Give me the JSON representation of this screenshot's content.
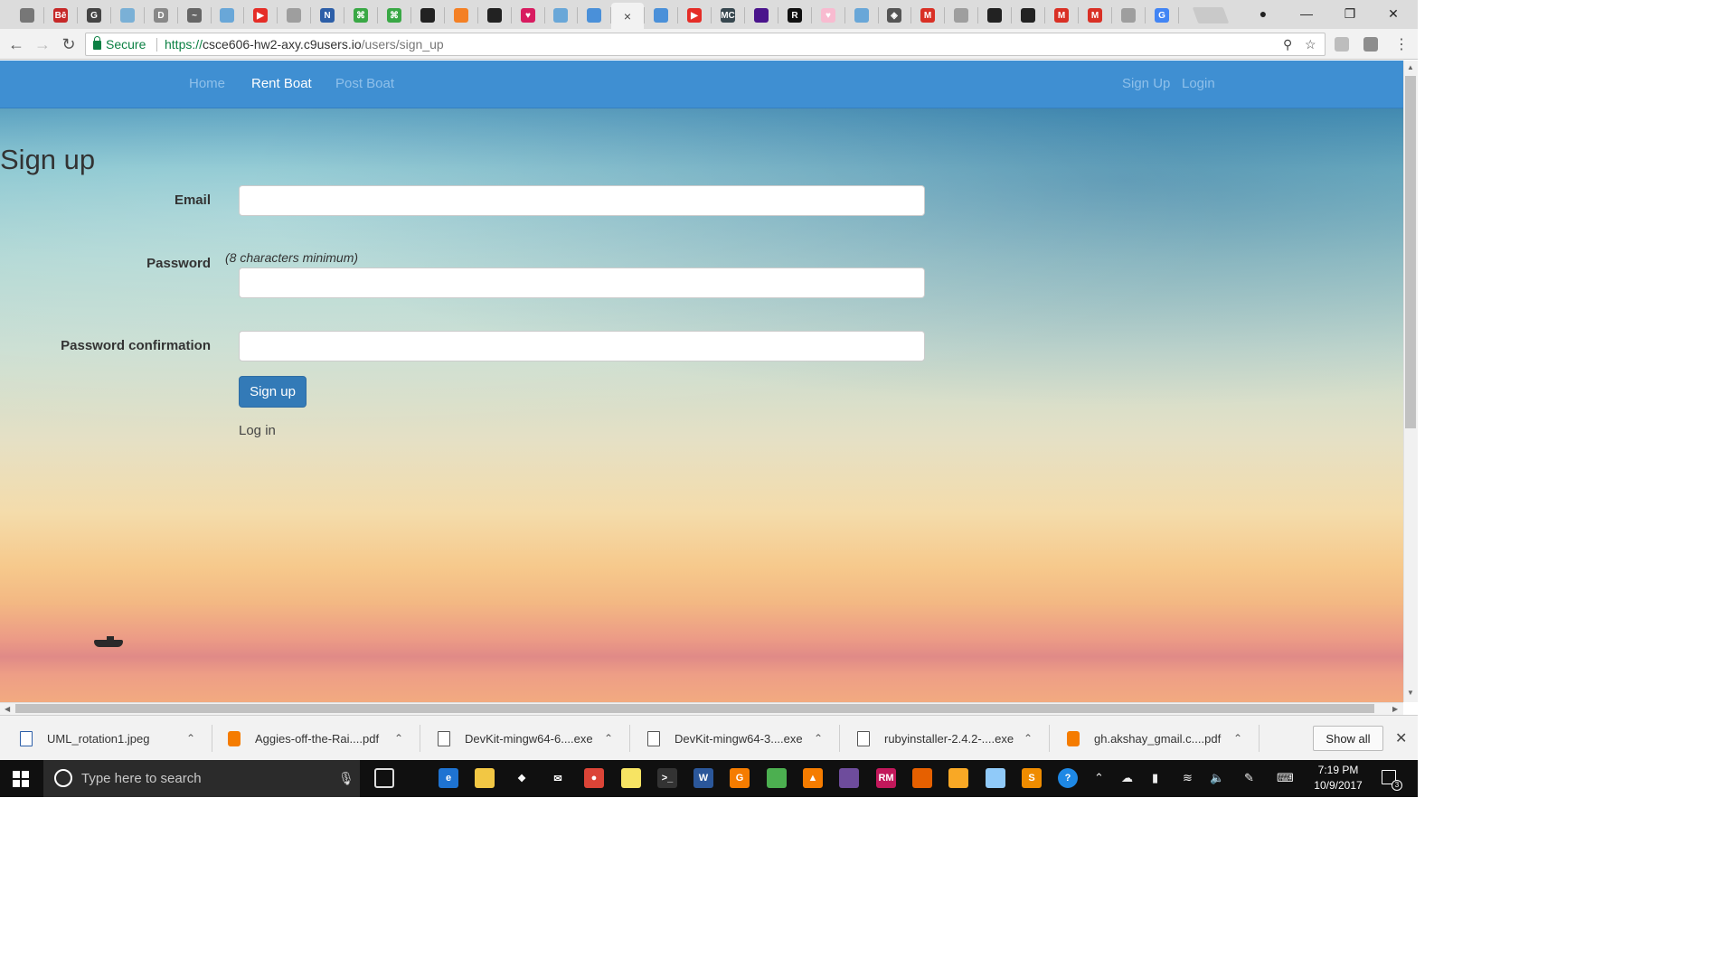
{
  "browser": {
    "tabs": [
      {
        "icon": "page-icon",
        "color": "#777777",
        "letter": ""
      },
      {
        "icon": "behance-icon",
        "color": "#c62828",
        "letter": "Bē"
      },
      {
        "icon": "g-icon",
        "color": "#444444",
        "letter": "G"
      },
      {
        "icon": "pin-icon",
        "color": "#7ab0d6",
        "letter": ""
      },
      {
        "icon": "doc-icon",
        "color": "#888888",
        "letter": "D"
      },
      {
        "icon": "signature-icon",
        "color": "#666666",
        "letter": "~"
      },
      {
        "icon": "wave-icon",
        "color": "#69a7d8",
        "letter": ""
      },
      {
        "icon": "youtube-icon",
        "color": "#e52d27",
        "letter": "▶"
      },
      {
        "icon": "file-icon",
        "color": "#9e9e9e",
        "letter": ""
      },
      {
        "icon": "n-icon",
        "color": "#2d5fa8",
        "letter": "N"
      },
      {
        "icon": "command-icon",
        "color": "#39a845",
        "letter": "⌘"
      },
      {
        "icon": "command-icon",
        "color": "#39a845",
        "letter": "⌘"
      },
      {
        "icon": "github-icon",
        "color": "#222222",
        "letter": ""
      },
      {
        "icon": "stack-icon",
        "color": "#f48024",
        "letter": ""
      },
      {
        "icon": "github-icon",
        "color": "#222222",
        "letter": ""
      },
      {
        "icon": "heart-icon",
        "color": "#d81b60",
        "letter": "♥"
      },
      {
        "icon": "wave-icon",
        "color": "#69a7d8",
        "letter": ""
      },
      {
        "icon": "eye-icon",
        "color": "#4a90d9",
        "letter": ""
      },
      {
        "icon": "close-icon",
        "color": "",
        "letter": "×"
      },
      {
        "icon": "eye-icon",
        "color": "#4a90d9",
        "letter": ""
      },
      {
        "icon": "youtube-icon",
        "color": "#e52d27",
        "letter": "▶"
      },
      {
        "icon": "mc-icon",
        "color": "#37474f",
        "letter": "MC"
      },
      {
        "icon": "film-icon",
        "color": "#4a148c",
        "letter": ""
      },
      {
        "icon": "r-icon",
        "color": "#111111",
        "letter": "R"
      },
      {
        "icon": "heart-icon",
        "color": "#f8bbd0",
        "letter": "♥"
      },
      {
        "icon": "wave-icon",
        "color": "#69a7d8",
        "letter": ""
      },
      {
        "icon": "diamond-icon",
        "color": "#555555",
        "letter": "◈"
      },
      {
        "icon": "gmail-icon",
        "color": "#d93025",
        "letter": "M"
      },
      {
        "icon": "file-icon",
        "color": "#9e9e9e",
        "letter": ""
      },
      {
        "icon": "github-icon",
        "color": "#222222",
        "letter": ""
      },
      {
        "icon": "github-icon",
        "color": "#222222",
        "letter": ""
      },
      {
        "icon": "gmail-icon",
        "color": "#d93025",
        "letter": "M"
      },
      {
        "icon": "gmail-icon",
        "color": "#d93025",
        "letter": "M"
      },
      {
        "icon": "file-icon",
        "color": "#9e9e9e",
        "letter": ""
      },
      {
        "icon": "google-icon",
        "color": "#4285f4",
        "letter": "G"
      }
    ],
    "secure_label": "Secure",
    "url_scheme": "https://",
    "url_host": "csce606-hw2-axy.c9users.io",
    "url_path": "/users/sign_up"
  },
  "navbar": {
    "links_left": [
      "Home",
      "Rent Boat",
      "Post Boat"
    ],
    "active_index": 1,
    "links_right": [
      "Sign Up",
      "Login"
    ]
  },
  "form": {
    "title": "Sign up",
    "email_label": "Email",
    "password_label": "Password",
    "password_hint": "(8 characters minimum)",
    "password_confirmation_label": "Password confirmation",
    "submit_label": "Sign up",
    "login_link": "Log in"
  },
  "downloads": {
    "items": [
      {
        "name": "UML_rotation1.jpeg",
        "icon": "image-file-icon"
      },
      {
        "name": "Aggies-off-the-Rai....pdf",
        "icon": "pdf-icon"
      },
      {
        "name": "DevKit-mingw64-6....exe",
        "icon": "archive-icon"
      },
      {
        "name": "DevKit-mingw64-3....exe",
        "icon": "archive-icon"
      },
      {
        "name": "rubyinstaller-2.4.2-....exe",
        "icon": "installer-icon"
      },
      {
        "name": "gh.akshay_gmail.c....pdf",
        "icon": "pdf-icon"
      }
    ],
    "show_all_label": "Show all"
  },
  "taskbar": {
    "search_placeholder": "Type here to search",
    "time": "7:19 PM",
    "date": "10/9/2017",
    "notification_count": "3",
    "apps": [
      {
        "icon": "edge-icon",
        "color": "#1e73d2",
        "letter": "e"
      },
      {
        "icon": "file-explorer-icon",
        "color": "#f2c744",
        "letter": ""
      },
      {
        "icon": "dropbox-icon",
        "color": "#101010",
        "letter": "❖"
      },
      {
        "icon": "mail-icon",
        "color": "#101010",
        "letter": "✉"
      },
      {
        "icon": "chrome-icon",
        "color": "#db4437",
        "letter": "●"
      },
      {
        "icon": "sticky-notes-icon",
        "color": "#f7e463",
        "letter": ""
      },
      {
        "icon": "terminal-icon",
        "color": "#333333",
        "letter": ">_"
      },
      {
        "icon": "word-icon",
        "color": "#2b579a",
        "letter": "W"
      },
      {
        "icon": "pdf-reader-icon",
        "color": "#f57c00",
        "letter": "G"
      },
      {
        "icon": "paint-icon",
        "color": "#4caf50",
        "letter": ""
      },
      {
        "icon": "vlc-icon",
        "color": "#f57c00",
        "letter": "▲"
      },
      {
        "icon": "github-desktop-icon",
        "color": "#6e4c9c",
        "letter": ""
      },
      {
        "icon": "rubymine-icon",
        "color": "#c2185b",
        "letter": "RM"
      },
      {
        "icon": "firefox-icon",
        "color": "#e66000",
        "letter": ""
      },
      {
        "icon": "puzzle-icon",
        "color": "#f9a825",
        "letter": ""
      },
      {
        "icon": "pen-tool-icon",
        "color": "#90caf9",
        "letter": ""
      },
      {
        "icon": "sublime-icon",
        "color": "#ef8c00",
        "letter": "S"
      },
      {
        "icon": "help-icon",
        "color": "#1e88e5",
        "letter": "?"
      }
    ]
  }
}
